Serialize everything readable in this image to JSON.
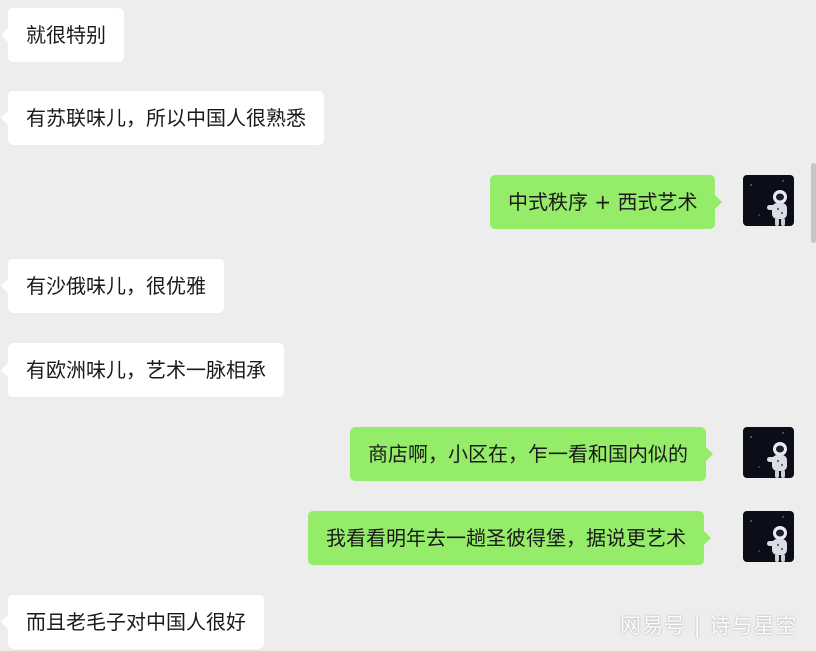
{
  "messages": [
    {
      "side": "left",
      "text": "就很特别"
    },
    {
      "side": "left",
      "text": "有苏联味儿，所以中国人很熟悉"
    },
    {
      "side": "right",
      "text": "中式秩序 + 西式艺术",
      "avatar_icon": "astronaut-avatar-icon"
    },
    {
      "side": "left",
      "text": "有沙俄味儿，很优雅"
    },
    {
      "side": "left",
      "text": "有欧洲味儿，艺术一脉相承"
    },
    {
      "side": "right",
      "text": "商店啊，小区在，乍一看和国内似的",
      "avatar_icon": "astronaut-avatar-icon"
    },
    {
      "side": "right",
      "text": "我看看明年去一趟圣彼得堡，据说更艺术",
      "avatar_icon": "astronaut-avatar-icon"
    },
    {
      "side": "left",
      "text": "而且老毛子对中国人很好"
    }
  ],
  "watermark": "网易号 | 诗与星空",
  "colors": {
    "background": "#ededed",
    "left_bubble": "#ffffff",
    "right_bubble": "#95ec69",
    "avatar_bg": "#0b0e18"
  }
}
